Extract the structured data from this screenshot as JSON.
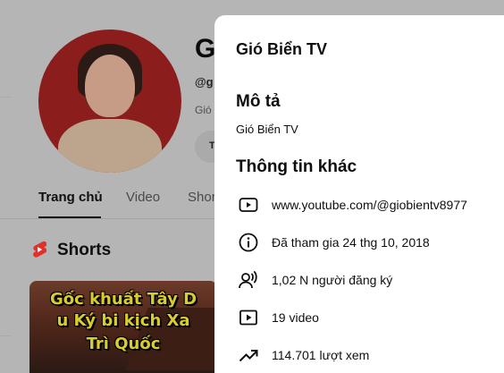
{
  "background": {
    "channel_name": "Gi",
    "handle": "@g",
    "description_snippet": "Gió",
    "chip_label": "T",
    "tabs": [
      {
        "label": "Trang chủ",
        "active": true
      },
      {
        "label": "Video",
        "active": false
      },
      {
        "label": "Shor",
        "active": false
      }
    ],
    "shorts_label": "Shorts",
    "thumbnail_lines": [
      "Gốc khuất Tây D",
      "u Ký bi kịch Xa",
      "Trì Quốc"
    ]
  },
  "about_panel": {
    "title": "Gió Biển TV",
    "description_heading": "Mô tả",
    "description": "Gió Biển TV",
    "other_info_heading": "Thông tin khác",
    "items": [
      {
        "icon": "youtube-link-icon",
        "text": "www.youtube.com/@giobientv8977"
      },
      {
        "icon": "info-icon",
        "text": "Đã tham gia 24 thg 10, 2018"
      },
      {
        "icon": "subscribers-icon",
        "text": "1,02 N người đăng ký"
      },
      {
        "icon": "video-icon",
        "text": "19 video"
      },
      {
        "icon": "trending-icon",
        "text": "114.701 lượt xem"
      }
    ]
  },
  "colors": {
    "overlay_bg": "#b5b5b5",
    "panel_bg": "#ffffff",
    "text_primary": "#0f0f0f",
    "shorts_red": "#e0312a",
    "thumbnail_text": "#d8cc2e"
  }
}
